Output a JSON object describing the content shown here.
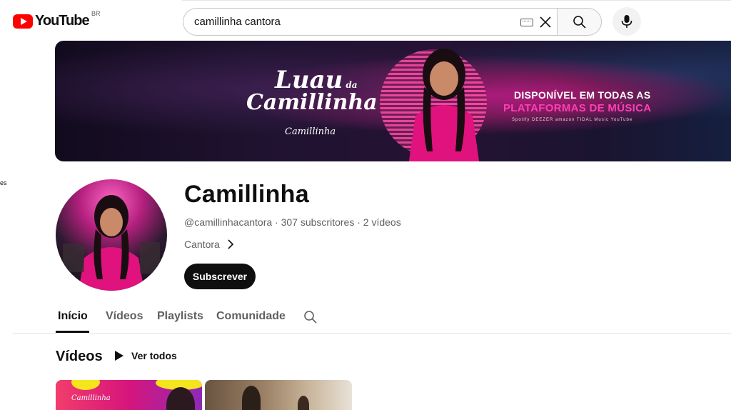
{
  "header": {
    "logo_text": "YouTube",
    "country_code": "BR",
    "search_value": "camillinha cantora"
  },
  "side_crop_text": "es",
  "banner": {
    "title_line1": "Luau",
    "title_small": "da",
    "title_line2": "Camillinha",
    "signature": "Camillinha",
    "right_line1": "DISPONÍVEL EM TODAS AS",
    "right_line2": "PLATAFORMAS DE MÚSICA",
    "platforms": "Spotify  DEEZER  amazon  TIDAL  Music  YouTube"
  },
  "channel": {
    "name": "Camillinha",
    "handle": "@camillinhacantora",
    "subscribers": "307 subscritores",
    "videos_count": "2 vídeos",
    "description": "Cantora",
    "subscribe_label": "Subscrever"
  },
  "tabs": [
    {
      "label": "Início",
      "active": true
    },
    {
      "label": "Vídeos",
      "active": false
    },
    {
      "label": "Playlists",
      "active": false
    },
    {
      "label": "Comunidade",
      "active": false
    }
  ],
  "videos_section": {
    "title": "Vídeos",
    "play_all_label": "Ver todos",
    "thumb1_signature": "Camillinha"
  },
  "colors": {
    "brand_red": "#ff0000",
    "text_primary": "#0f0f0f",
    "text_secondary": "#606060",
    "banner_pink": "#ff3fb4"
  },
  "icons": [
    "keyboard-icon",
    "close-icon",
    "search-icon",
    "mic-icon",
    "chevron-right-icon",
    "play-icon"
  ]
}
